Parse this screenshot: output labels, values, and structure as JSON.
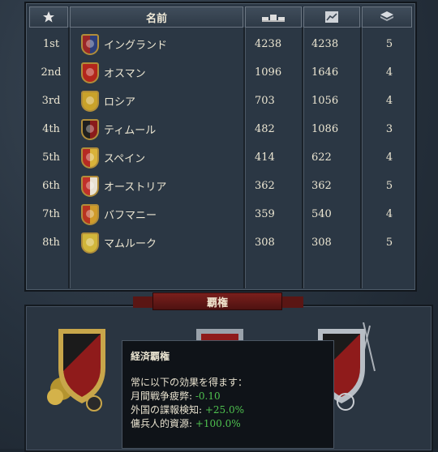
{
  "table": {
    "headers": {
      "rank_icon": "star-icon",
      "name": "名前",
      "col1_icon": "ships-icon",
      "col2_icon": "trend-chart-icon",
      "col3_icon": "stack-icon"
    },
    "rows": [
      {
        "rank": "1st",
        "name": "イングランド",
        "v1": "4238",
        "v2": "4238",
        "v3": "5",
        "shield": "#9a2626",
        "shield2": "#2c3e7a"
      },
      {
        "rank": "2nd",
        "name": "オスマン",
        "v1": "1096",
        "v2": "1646",
        "v3": "4",
        "shield": "#b3261c",
        "shield2": "#b3261c"
      },
      {
        "rank": "3rd",
        "name": "ロシア",
        "v1": "703",
        "v2": "1056",
        "v3": "4",
        "shield": "#c9a22a",
        "shield2": "#c9a22a"
      },
      {
        "rank": "4th",
        "name": "ティムール",
        "v1": "482",
        "v2": "1086",
        "v3": "3",
        "shield": "#1f1f1f",
        "shield2": "#8a1b1b"
      },
      {
        "rank": "5th",
        "name": "スペイン",
        "v1": "414",
        "v2": "622",
        "v3": "4",
        "shield": "#b52a23",
        "shield2": "#d8b23a"
      },
      {
        "rank": "6th",
        "name": "オーストリア",
        "v1": "362",
        "v2": "362",
        "v3": "5",
        "shield": "#c0302a",
        "shield2": "#e9e2d3"
      },
      {
        "rank": "7th",
        "name": "バフマニー",
        "v1": "359",
        "v2": "540",
        "v3": "4",
        "shield": "#b8331f",
        "shield2": "#cf9b2b"
      },
      {
        "rank": "8th",
        "name": "マムルーク",
        "v1": "308",
        "v2": "308",
        "v3": "5",
        "shield": "#d1b63b",
        "shield2": "#d1b63b"
      }
    ]
  },
  "hegemony": {
    "banner_label": "覇権"
  },
  "tooltip": {
    "title": "経済覇権",
    "intro": "常に以下の効果を得ます：",
    "lines": [
      {
        "label": "月間戦争疲弊: ",
        "value": "-0.10"
      },
      {
        "label": "外国の諜報検知: ",
        "value": "+25.0%"
      },
      {
        "label": "傭兵人的資源: ",
        "value": "+100.0%"
      }
    ]
  },
  "colors": {
    "positive": "#4fc24f",
    "banner": "#7a1f1c"
  }
}
